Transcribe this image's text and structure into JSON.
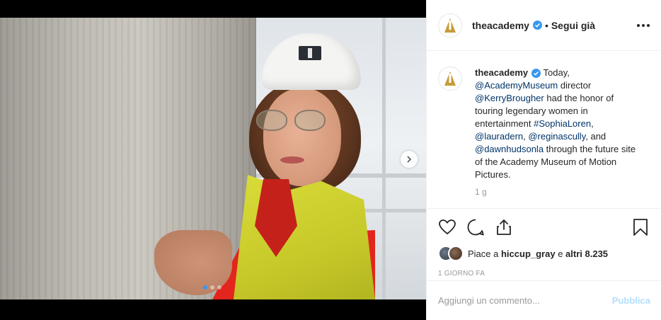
{
  "post": {
    "username": "theacademy",
    "follow_separator": "•",
    "follow_label": "Segui già",
    "caption": {
      "username": "theacademy",
      "segments": [
        {
          "type": "text",
          "value": " Today, "
        },
        {
          "type": "link",
          "value": "@AcademyMuseum"
        },
        {
          "type": "text",
          "value": " director "
        },
        {
          "type": "link",
          "value": "@KerryBrougher"
        },
        {
          "type": "text",
          "value": " had the honor of touring legendary women in entertainment "
        },
        {
          "type": "link",
          "value": "#SophiaLoren"
        },
        {
          "type": "text",
          "value": ", "
        },
        {
          "type": "link",
          "value": "@lauradern"
        },
        {
          "type": "text",
          "value": ", "
        },
        {
          "type": "link",
          "value": "@reginascully"
        },
        {
          "type": "text",
          "value": ", and "
        },
        {
          "type": "link",
          "value": "@dawnhudsonla"
        },
        {
          "type": "text",
          "value": " through the future site of the Academy Museum of Motion Pictures."
        }
      ]
    },
    "caption_time": "1 g",
    "likes": {
      "prefix": "Piace a ",
      "user": "hiccup_gray",
      "middle": " e ",
      "others": "altri 8.235"
    },
    "posted_ago": "1 GIORNO FA",
    "comment_placeholder": "Aggiungi un commento...",
    "publish_label": "Pubblica"
  },
  "carousel": {
    "dots": 3,
    "active_index": 0
  },
  "icons": {
    "logo": "oscar-statuette-icon",
    "verified": "verified-badge-icon",
    "more": "more-options-icon",
    "like": "heart-icon",
    "comment": "comment-bubble-icon",
    "share": "share-icon",
    "save": "bookmark-icon",
    "next": "chevron-right-icon"
  },
  "colors": {
    "link": "#003569",
    "verified": "#3897f0",
    "publish_disabled": "#b2dffc",
    "oscar_gold": "#c69c3b"
  }
}
